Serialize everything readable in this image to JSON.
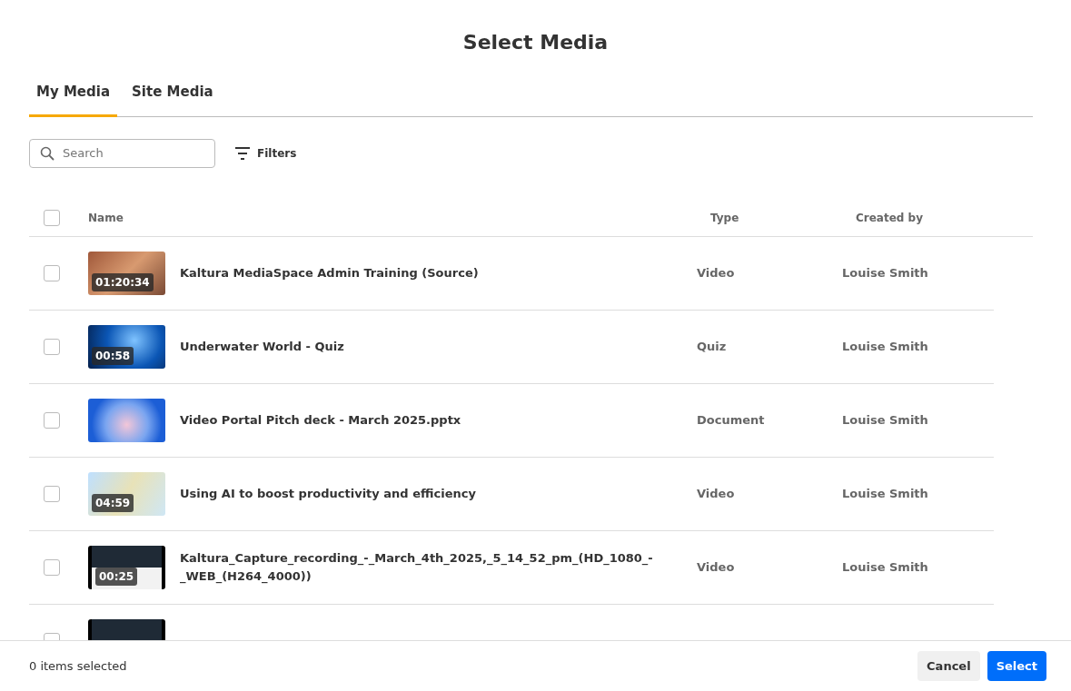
{
  "title": "Select Media",
  "tabs": [
    {
      "label": "My Media",
      "selected": true
    },
    {
      "label": "Site Media",
      "selected": false
    }
  ],
  "search": {
    "placeholder": "Search"
  },
  "filters_label": "Filters",
  "table": {
    "select_all_checked": false,
    "columns": [
      "Name",
      "Type",
      "Created by"
    ],
    "rows": [
      {
        "checked": false,
        "kind": "brick",
        "duration": "01:20:34",
        "name": "Kaltura MediaSpace Admin Training (Source)",
        "type": "Video",
        "created_by": "Louise Smith"
      },
      {
        "checked": false,
        "kind": "underwater",
        "duration": "00:58",
        "name": "Underwater World - Quiz",
        "type": "Quiz",
        "created_by": "Louise Smith"
      },
      {
        "checked": false,
        "kind": "slides",
        "name": "Video Portal Pitch deck - March 2025.pptx",
        "type": "Document",
        "created_by": "Louise Smith"
      },
      {
        "checked": false,
        "kind": "presenter",
        "duration": "04:59",
        "name": "Using AI to boost productivity and efficiency",
        "type": "Video",
        "created_by": "Louise Smith"
      },
      {
        "checked": false,
        "kind": "screen",
        "duration": "00:25",
        "name": "Kaltura_Capture_recording_-_March_4th_2025,_5_14_52_pm_(HD_1080_-_WEB_(H264_4000))",
        "type": "Video",
        "created_by": "Louise Smith"
      },
      {
        "checked": false,
        "kind": "screen"
      }
    ]
  },
  "footer": {
    "status": "0 items selected",
    "buttons": [
      {
        "label": "Cancel",
        "kind": "secondary"
      },
      {
        "label": "Select",
        "kind": "primary"
      }
    ]
  }
}
